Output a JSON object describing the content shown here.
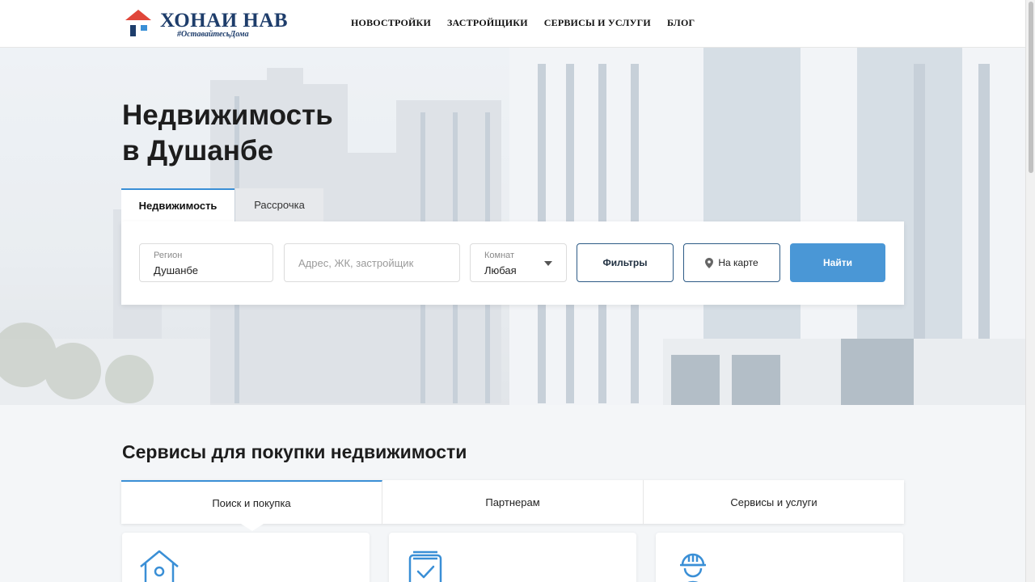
{
  "header": {
    "logo_title": "ХОНАИ НАВ",
    "logo_tagline": "#ОставайтесьДома",
    "nav": [
      "НОВОСТРОЙКИ",
      "ЗАСТРОЙЩИКИ",
      "СЕРВИСЫ И УСЛУГИ",
      "БЛОГ"
    ]
  },
  "hero": {
    "title_line1": "Недвижимость",
    "title_line2": "в Душанбе"
  },
  "search": {
    "tabs": [
      "Недвижимость",
      "Рассрочка"
    ],
    "active_tab": "Недвижимость",
    "region_label": "Регион",
    "region_value": "Душанбе",
    "address_placeholder": "Адрес, ЖК, застройщик",
    "rooms_label": "Комнат",
    "rooms_value": "Любая",
    "filters_label": "Фильтры",
    "map_label": "На карте",
    "find_label": "Найти"
  },
  "services": {
    "title": "Сервисы для покупки недвижимости",
    "tabs": [
      "Поиск и покупка",
      "Партнерам",
      "Сервисы и услуги"
    ],
    "active_tab": "Поиск и покупка",
    "card_icons": [
      "house-icon",
      "checklist-icon",
      "builder-icon"
    ]
  },
  "colors": {
    "accent": "#4a97d6",
    "brand": "#1e3d6b",
    "logo_roof": "#e0463a"
  }
}
